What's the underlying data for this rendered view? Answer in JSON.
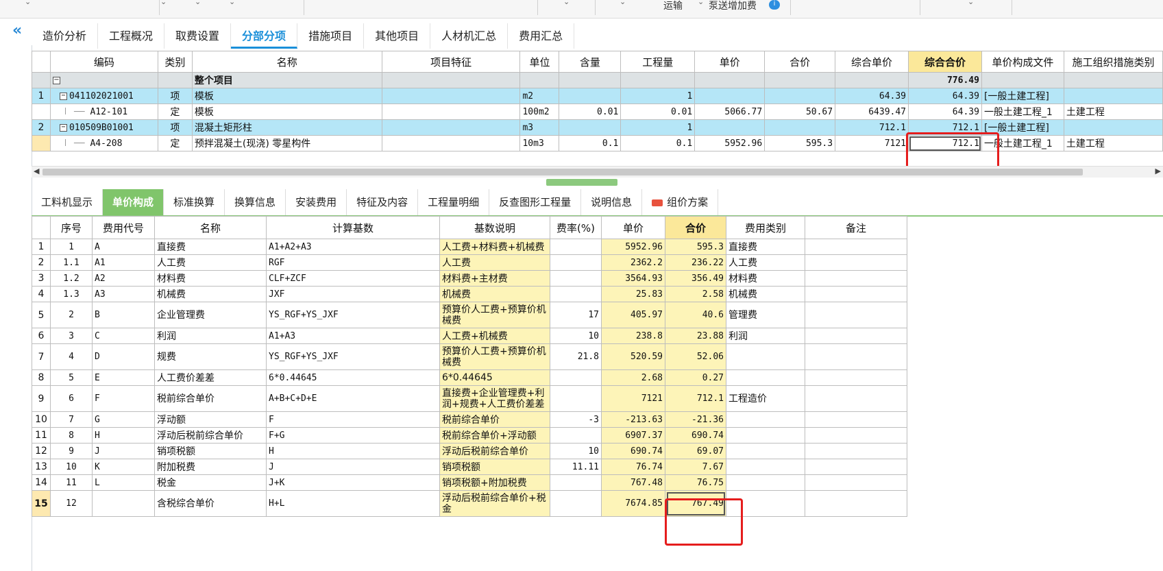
{
  "topbar": {
    "item1": "运输",
    "item2": "泵送增加费",
    "info_icon": "info-icon"
  },
  "main_tabs": [
    "造价分析",
    "工程概况",
    "取费设置",
    "分部分项",
    "措施项目",
    "其他项目",
    "人材机汇总",
    "费用汇总"
  ],
  "active_main_tab": "分部分项",
  "grid1": {
    "headers": [
      "编码",
      "类别",
      "名称",
      "项目特征",
      "单位",
      "含量",
      "工程量",
      "单价",
      "合价",
      "综合单价",
      "综合合价",
      "单价构成文件",
      "施工组织措施类别"
    ],
    "summary_row": {
      "name": "整个项目",
      "total": "776.49"
    },
    "rows": [
      {
        "no": "1",
        "code": "041102021001",
        "type": "项",
        "name": "模板",
        "feature": "",
        "unit": "m2",
        "content": "",
        "qty": "1",
        "price": "",
        "amount": "",
        "unit_total": "64.39",
        "total": "64.39",
        "file": "[一般土建工程]",
        "category": ""
      },
      {
        "no": "",
        "code": "A12-101",
        "type": "定",
        "name": "模板",
        "feature": "",
        "unit": "100m2",
        "content": "0.01",
        "qty": "0.01",
        "price": "5066.77",
        "amount": "50.67",
        "unit_total": "6439.47",
        "total": "64.39",
        "file": "一般土建工程_1",
        "category": "土建工程"
      },
      {
        "no": "2",
        "code": "010509B01001",
        "type": "项",
        "name": "混凝土矩形柱",
        "feature": "",
        "unit": "m3",
        "content": "",
        "qty": "1",
        "price": "",
        "amount": "",
        "unit_total": "712.1",
        "total": "712.1",
        "file": "[一般土建工程]",
        "category": ""
      },
      {
        "no": "",
        "code": "A4-208",
        "type": "定",
        "name": "预拌混凝土(现浇) 零星构件",
        "feature": "",
        "unit": "10m3",
        "content": "0.1",
        "qty": "0.1",
        "price": "5952.96",
        "amount": "595.3",
        "unit_total": "7121",
        "total": "712.1",
        "file": "一般土建工程_1",
        "category": "土建工程"
      }
    ]
  },
  "sub_tabs": [
    "工料机显示",
    "单价构成",
    "标准换算",
    "换算信息",
    "安装费用",
    "特征及内容",
    "工程量明细",
    "反查图形工程量",
    "说明信息",
    "组价方案"
  ],
  "active_sub_tab": "单价构成",
  "grid2": {
    "headers": [
      "序号",
      "费用代号",
      "名称",
      "计算基数",
      "基数说明",
      "费率(%)",
      "单价",
      "合价",
      "费用类别",
      "备注"
    ],
    "rows": [
      {
        "row": "1",
        "seq": "1",
        "code": "A",
        "name": "直接费",
        "base": "A1+A2+A3",
        "desc": "人工费+材料费+机械费",
        "rate": "",
        "price": "5952.96",
        "amount": "595.3",
        "cat": "直接费",
        "note": ""
      },
      {
        "row": "2",
        "seq": "1.1",
        "code": "A1",
        "name": "人工费",
        "base": "RGF",
        "desc": "人工费",
        "rate": "",
        "price": "2362.2",
        "amount": "236.22",
        "cat": "人工费",
        "note": ""
      },
      {
        "row": "3",
        "seq": "1.2",
        "code": "A2",
        "name": "材料费",
        "base": "CLF+ZCF",
        "desc": "材料费+主材费",
        "rate": "",
        "price": "3564.93",
        "amount": "356.49",
        "cat": "材料费",
        "note": ""
      },
      {
        "row": "4",
        "seq": "1.3",
        "code": "A3",
        "name": "机械费",
        "base": "JXF",
        "desc": "机械费",
        "rate": "",
        "price": "25.83",
        "amount": "2.58",
        "cat": "机械费",
        "note": ""
      },
      {
        "row": "5",
        "seq": "2",
        "code": "B",
        "name": "企业管理费",
        "base": "YS_RGF+YS_JXF",
        "desc": "预算价人工费+预算价机械费",
        "rate": "17",
        "price": "405.97",
        "amount": "40.6",
        "cat": "管理费",
        "note": ""
      },
      {
        "row": "6",
        "seq": "3",
        "code": "C",
        "name": "利润",
        "base": "A1+A3",
        "desc": "人工费+机械费",
        "rate": "10",
        "price": "238.8",
        "amount": "23.88",
        "cat": "利润",
        "note": ""
      },
      {
        "row": "7",
        "seq": "4",
        "code": "D",
        "name": "规费",
        "base": "YS_RGF+YS_JXF",
        "desc": "预算价人工费+预算价机械费",
        "rate": "21.8",
        "price": "520.59",
        "amount": "52.06",
        "cat": "",
        "note": ""
      },
      {
        "row": "8",
        "seq": "5",
        "code": "E",
        "name": "人工费价差差",
        "base": "6*0.44645",
        "desc": "6*0.44645",
        "rate": "",
        "price": "2.68",
        "amount": "0.27",
        "cat": "",
        "note": ""
      },
      {
        "row": "9",
        "seq": "6",
        "code": "F",
        "name": "税前综合单价",
        "base": "A+B+C+D+E",
        "desc": "直接费+企业管理费+利润+规费+人工费价差差",
        "rate": "",
        "price": "7121",
        "amount": "712.1",
        "cat": "工程造价",
        "note": ""
      },
      {
        "row": "10",
        "seq": "7",
        "code": "G",
        "name": "浮动额",
        "base": "F",
        "desc": "税前综合单价",
        "rate": "-3",
        "price": "-213.63",
        "amount": "-21.36",
        "cat": "",
        "note": ""
      },
      {
        "row": "11",
        "seq": "8",
        "code": "H",
        "name": "浮动后税前综合单价",
        "base": "F+G",
        "desc": "税前综合单价+浮动额",
        "rate": "",
        "price": "6907.37",
        "amount": "690.74",
        "cat": "",
        "note": ""
      },
      {
        "row": "12",
        "seq": "9",
        "code": "J",
        "name": "销项税额",
        "base": "H",
        "desc": "浮动后税前综合单价",
        "rate": "10",
        "price": "690.74",
        "amount": "69.07",
        "cat": "",
        "note": ""
      },
      {
        "row": "13",
        "seq": "10",
        "code": "K",
        "name": "附加税费",
        "base": "J",
        "desc": "销项税额",
        "rate": "11.11",
        "price": "76.74",
        "amount": "7.67",
        "cat": "",
        "note": ""
      },
      {
        "row": "14",
        "seq": "11",
        "code": "L",
        "name": "税金",
        "base": "J+K",
        "desc": "销项税额+附加税费",
        "rate": "",
        "price": "767.48",
        "amount": "76.75",
        "cat": "",
        "note": ""
      },
      {
        "row": "15",
        "seq": "12",
        "code": "",
        "name": "含税综合单价",
        "base": "H+L",
        "desc": "浮动后税前综合单价+税金",
        "rate": "",
        "price": "7674.85",
        "amount": "767.49",
        "cat": "",
        "note": ""
      }
    ]
  },
  "colors": {
    "accent": "#1a8fd9",
    "tab_green": "#80c56b",
    "row_blue": "#b5e6f7",
    "header_yellow": "#fbe89a",
    "cell_yellow": "#fdf4b8",
    "highlight_red": "#e51d1d"
  }
}
